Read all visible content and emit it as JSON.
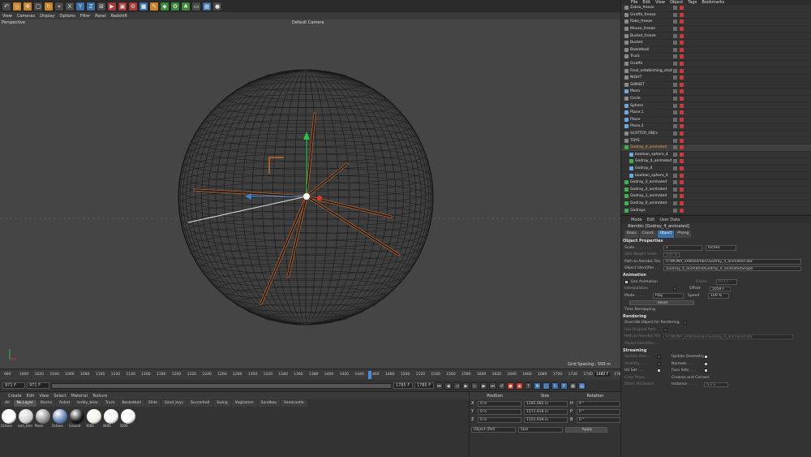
{
  "viewport": {
    "menu": [
      "View",
      "Cameras",
      "Display",
      "Options",
      "Filter",
      "Panel",
      "Redshift"
    ],
    "label": "Perspective",
    "camera": "Default Camera",
    "grid_spacing": "Grid Spacing : 500 m"
  },
  "timeline": {
    "ticks": [
      "980",
      "1000",
      "1020",
      "1040",
      "1060",
      "1080",
      "1100",
      "1120",
      "1140",
      "1160",
      "1180",
      "1200",
      "1220",
      "1240",
      "1260",
      "1280",
      "1300",
      "1320",
      "1340",
      "1360",
      "1380",
      "1400",
      "1420",
      "1440",
      "1460",
      "1480",
      "1500",
      "1520",
      "1540",
      "1560",
      "1580",
      "1600",
      "1620",
      "1640",
      "1660",
      "1680",
      "1700",
      "1720",
      "1740",
      "1760",
      "1780"
    ],
    "current": "1482 F",
    "current_field": "1482 F"
  },
  "transport": {
    "start": "971 F",
    "start2": "971 F",
    "end": "1785 F",
    "end2": "1785 F"
  },
  "materials": {
    "menu": [
      "Create",
      "Edit",
      "View",
      "Select",
      "Material",
      "Texture"
    ],
    "tabs": [
      "All",
      "No Layer",
      "Blocks",
      "Robot",
      "teddy_bear",
      "Truck",
      "Basketball",
      "Slide",
      "Sand_toys",
      "Soccerball",
      "Swing",
      "Vegitation",
      "Sandbox",
      "Sandcastle"
    ],
    "active_tab": "No Layer",
    "items": [
      {
        "name": "Octane",
        "color": "#ffffff"
      },
      {
        "name": "som_tem",
        "color": "#d0d0d0"
      },
      {
        "name": "Moon",
        "color": "#8a8a8a"
      },
      {
        "name": "Octane",
        "color": "#5b7db0"
      },
      {
        "name": "Ground",
        "color": "#111111"
      },
      {
        "name": "3000",
        "color": "#f4f0e6"
      },
      {
        "name": "4000",
        "color": "#f6f6f6"
      },
      {
        "name": "5000",
        "color": "#fafafa"
      }
    ]
  },
  "coords": {
    "headers": [
      "Position",
      "Size",
      "Rotation"
    ],
    "rows": [
      {
        "axis": "X",
        "pos": "0 in",
        "size": "1185.082 in",
        "rot_axis": "H",
        "rot": "0 °"
      },
      {
        "axis": "Y",
        "pos": "0 in",
        "size": "1571.818 in",
        "rot_axis": "P",
        "rot": "0 °"
      },
      {
        "axis": "Z",
        "pos": "0 in",
        "size": "1151.939 in",
        "rot_axis": "B",
        "rot": "0 °"
      }
    ],
    "mode": "Object (Rel)",
    "size_mode": "Size",
    "apply": "Apply"
  },
  "objects": {
    "menu": [
      "File",
      "Edit",
      "View",
      "Object",
      "Tags",
      "Bookmarks"
    ],
    "items": [
      "Zebra_freeze",
      "Giraffe_freeze",
      "Rake_freeze",
      "Mouse_freeze",
      "Bucket_freeze",
      "Bucket",
      "Basketball",
      "Truck",
      "Giraffe",
      "Final_establishing_shot",
      "NIGHT",
      "SUNSET",
      "Moon",
      "Circle",
      "Sphere",
      "Plane.1",
      "Plane",
      "Plane.2",
      "SCATTER_OBJ's",
      "TOYS",
      "Godray_4_animated",
      "boolean_sphere_4",
      "Godray_4_animated",
      "Godray_4",
      "boolean_sphere_4",
      "Godray_3_animated",
      "Godray_2_animated",
      "Godray_1_animated",
      "Godray_0_animated",
      "Godrays"
    ],
    "highlighted": "Godray_4_animated"
  },
  "attributes": {
    "menu": [
      "Mode",
      "Edit",
      "User Data"
    ],
    "title": "Alembic [Godray_4_animated]",
    "tabs": [
      "Basic",
      "Coord.",
      "Object",
      "Phong"
    ],
    "active_tab": "Object",
    "object_props": {
      "heading": "Object Properties",
      "scale_label": "Scale . . . . . . .",
      "scale_value": "1",
      "scale_unit": "Inches",
      "sds_label": "SDS Weight Scale",
      "sds_value": "100 %",
      "path_label": "Path to Alembic File",
      "path_value": "H:\\MONA_SAN\\alembic\\Godray_4_animated.abc",
      "id_label": "Object Identifier . .",
      "id_value": "/Godray_4_animated/Godray_4_animatedShape"
    },
    "animation": {
      "heading": "Animation",
      "use_label": "Use Animation",
      "frame_label": "Frame",
      "frame_value": "971 F",
      "interp_label": "Interpolation",
      "offset_label": "Offset",
      "offset_value": "1059 F",
      "mode_label": "Mode . . . .",
      "mode_value": "Play",
      "speed_label": "Speed",
      "speed_value": "100 %",
      "reset": "Reset",
      "remap": "Time Remapping"
    },
    "rendering": {
      "heading": "Rendering",
      "override_label": "Override Object for Rendering",
      "use_orig_label": "Use Original Path . . .",
      "path_label": "Path to Alembic File",
      "path_value": "H:\\MONA_SAN\\alembic\\Godray_4_animated.abc",
      "id_label": "Object Identifier . ."
    },
    "streaming": {
      "heading": "Streaming",
      "left": [
        "Update Poin...",
        "Visibility . . .",
        "UV Set . . .",
        "Color Maps . .",
        "Other Attributes"
      ],
      "right": [
        "Update Geometry",
        "Normals . . .",
        "Face Sets . . .",
        "Creases and Corners",
        "Instance . . . ."
      ],
      "instance_value": "None"
    }
  }
}
